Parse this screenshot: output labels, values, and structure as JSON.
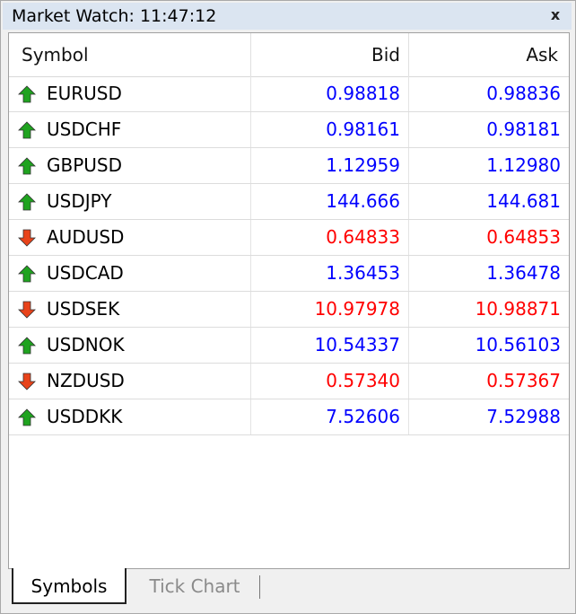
{
  "window": {
    "title": "Market Watch: 11:47:12",
    "close_glyph": "x"
  },
  "table": {
    "headers": {
      "symbol": "Symbol",
      "bid": "Bid",
      "ask": "Ask"
    },
    "rows": [
      {
        "symbol": "EURUSD",
        "bid": "0.98818",
        "ask": "0.98836",
        "direction": "up"
      },
      {
        "symbol": "USDCHF",
        "bid": "0.98161",
        "ask": "0.98181",
        "direction": "up"
      },
      {
        "symbol": "GBPUSD",
        "bid": "1.12959",
        "ask": "1.12980",
        "direction": "up"
      },
      {
        "symbol": "USDJPY",
        "bid": "144.666",
        "ask": "144.681",
        "direction": "up"
      },
      {
        "symbol": "AUDUSD",
        "bid": "0.64833",
        "ask": "0.64853",
        "direction": "down"
      },
      {
        "symbol": "USDCAD",
        "bid": "1.36453",
        "ask": "1.36478",
        "direction": "up"
      },
      {
        "symbol": "USDSEK",
        "bid": "10.97978",
        "ask": "10.98871",
        "direction": "down"
      },
      {
        "symbol": "USDNOK",
        "bid": "10.54337",
        "ask": "10.56103",
        "direction": "up"
      },
      {
        "symbol": "NZDUSD",
        "bid": "0.57340",
        "ask": "0.57367",
        "direction": "down"
      },
      {
        "symbol": "USDDKK",
        "bid": "7.52606",
        "ask": "7.52988",
        "direction": "up"
      }
    ]
  },
  "tabs": [
    {
      "label": "Symbols",
      "active": true
    },
    {
      "label": "Tick Chart",
      "active": false
    }
  ],
  "colors": {
    "up_price": "#0000ff",
    "down_price": "#ff0000",
    "up_arrow": "#1fa31f",
    "down_arrow": "#e8431a",
    "titlebar": "#dbe5f1"
  },
  "icons": {
    "up": "arrow-up-green-icon",
    "down": "arrow-down-red-icon"
  }
}
